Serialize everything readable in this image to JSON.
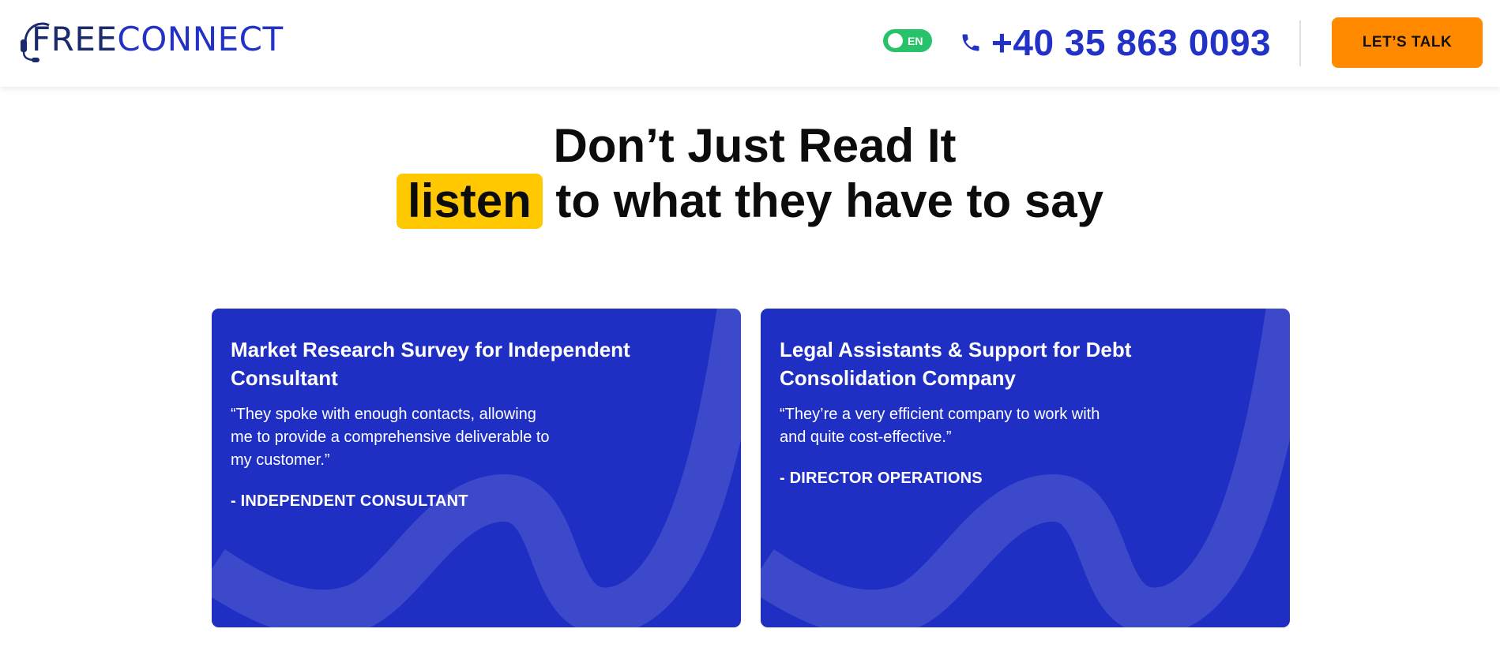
{
  "header": {
    "logo": {
      "part1": "FREE",
      "part2": "CONNECT"
    },
    "language": "EN",
    "phone": "+40 35 863 0093",
    "cta_label": "LET’S TALK"
  },
  "hero": {
    "line1": "Don’t Just Read It",
    "highlight": "listen",
    "line2_rest": " to what they have to say"
  },
  "testimonials": [
    {
      "title": "Market Research Survey for Independent Consultant",
      "quote": "“They spoke with enough contacts, allowing me to provide a comprehensive deliverable to my customer.”",
      "author": "- INDEPENDENT CONSULTANT"
    },
    {
      "title": "Legal Assistants & Support for Debt Consolidation Company",
      "quote": "“They’re a very efficient company to work with and quite cost-effective.”",
      "author": "- DIRECTOR OPERATIONS"
    }
  ],
  "colors": {
    "brand_blue": "#2232c6",
    "card_blue": "#1f2fc4",
    "cta_orange": "#ff8a00",
    "highlight_yellow": "#ffc800",
    "toggle_green": "#27c26a"
  },
  "icons": [
    "headset-icon",
    "phone-icon",
    "toggle-knob"
  ]
}
